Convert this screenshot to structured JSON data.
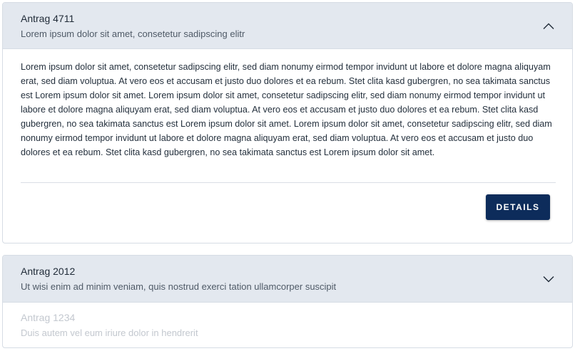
{
  "panels": [
    {
      "title": "Antrag 4711",
      "subtitle": "Lorem ipsum dolor sit amet, consetetur sadipscing elitr",
      "expanded": true,
      "toggle_icon": "chevron-up-icon",
      "body": "Lorem ipsum dolor sit amet, consetetur sadipscing elitr, sed diam nonumy eirmod tempor invidunt ut labore et dolore magna aliquyam erat, sed diam voluptua. At vero eos et accusam et justo duo dolores et ea rebum. Stet clita kasd gubergren, no sea takimata sanctus est Lorem ipsum dolor sit amet. Lorem ipsum dolor sit amet, consetetur sadipscing elitr, sed diam nonumy eirmod tempor invidunt ut labore et dolore magna aliquyam erat, sed diam voluptua. At vero eos et accusam et justo duo dolores et ea rebum. Stet clita kasd gubergren, no sea takimata sanctus est Lorem ipsum dolor sit amet. Lorem ipsum dolor sit amet, consetetur sadipscing elitr, sed diam nonumy eirmod tempor invidunt ut labore et dolore magna aliquyam erat, sed diam voluptua. At vero eos et accusam et justo duo dolores et ea rebum. Stet clita kasd gubergren, no sea takimata sanctus est Lorem ipsum dolor sit amet.",
      "button_label": "DETAILS"
    },
    {
      "title": "Antrag 2012",
      "subtitle": "Ut wisi enim ad minim veniam, quis nostrud exerci tation ullamcorper suscipit",
      "expanded": false,
      "toggle_icon": "chevron-down-icon",
      "items": [
        {
          "title": "Antrag 1234",
          "subtitle": "Duis autem vel eum iriure dolor in hendrerit",
          "disabled": true
        }
      ]
    }
  ],
  "colors": {
    "header_bg": "#e3e8ef",
    "button_bg": "#0d2c5b",
    "disabled_text": "#c3c8cf"
  }
}
